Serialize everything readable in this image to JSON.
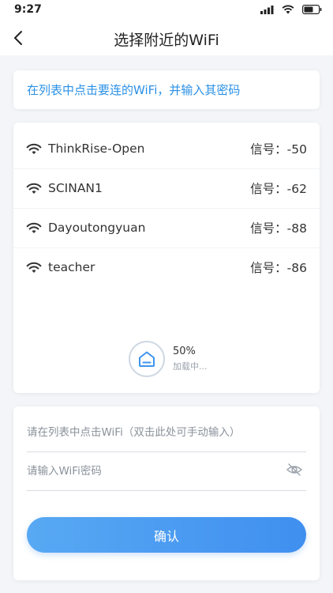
{
  "status_bar": {
    "time": "9:27"
  },
  "header": {
    "title": "选择附近的WiFi"
  },
  "tip": "在列表中点击要连的WiFi，并输入其密码",
  "signal_label": "信号：",
  "networks": [
    {
      "ssid": "ThinkRise-Open",
      "signal": "-50"
    },
    {
      "ssid": "SCINAN1",
      "signal": "-62"
    },
    {
      "ssid": "Dayoutongyuan",
      "signal": "-88"
    },
    {
      "ssid": "teacher",
      "signal": "-86"
    }
  ],
  "loading": {
    "percent": "50%",
    "text": "加载中..."
  },
  "form": {
    "ssid_placeholder": "请在列表中点击WiFi（双击此处可手动输入）",
    "password_placeholder": "请输入WiFi密码",
    "confirm_label": "确认"
  },
  "colors": {
    "accent": "#2b91e6",
    "button_start": "#58a9f3",
    "button_end": "#3f8ff0"
  }
}
